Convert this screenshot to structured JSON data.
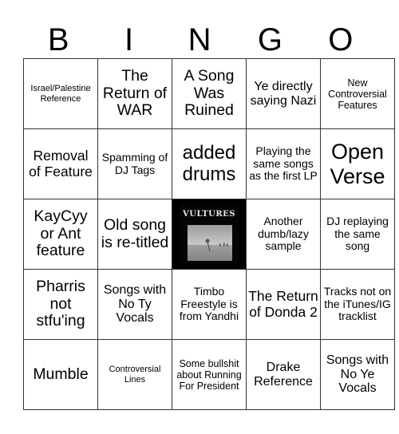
{
  "header": {
    "letters": [
      "B",
      "I",
      "N",
      "G",
      "O"
    ]
  },
  "rows": [
    [
      "Israel/Palestine Reference",
      "The Return of WAR",
      "A Song Was Ruined",
      "Ye directly saying Nazi",
      "New Controversial Features"
    ],
    [
      "Removal of Feature",
      "Spamming of DJ Tags",
      "added drums",
      "Playing the same songs as the first LP",
      "Open Verse"
    ],
    [
      "KayCyy or Ant feature",
      "Old song is re-titled",
      "",
      "Another dumb/lazy sample",
      "DJ replaying the same song"
    ],
    [
      "Pharris not stfu'ing",
      "Songs with No Ty Vocals",
      "Timbo Freestyle is from Yandhi",
      "The Return of Donda 2",
      "Tracks not on the iTunes/IG tracklist"
    ],
    [
      "Mumble",
      "Controversial Lines",
      "Some bullshit about Running For President",
      "Drake Reference",
      "Songs with No Ye Vocals"
    ]
  ],
  "free_space": {
    "image": "album-cover",
    "title": "VULTURES"
  }
}
